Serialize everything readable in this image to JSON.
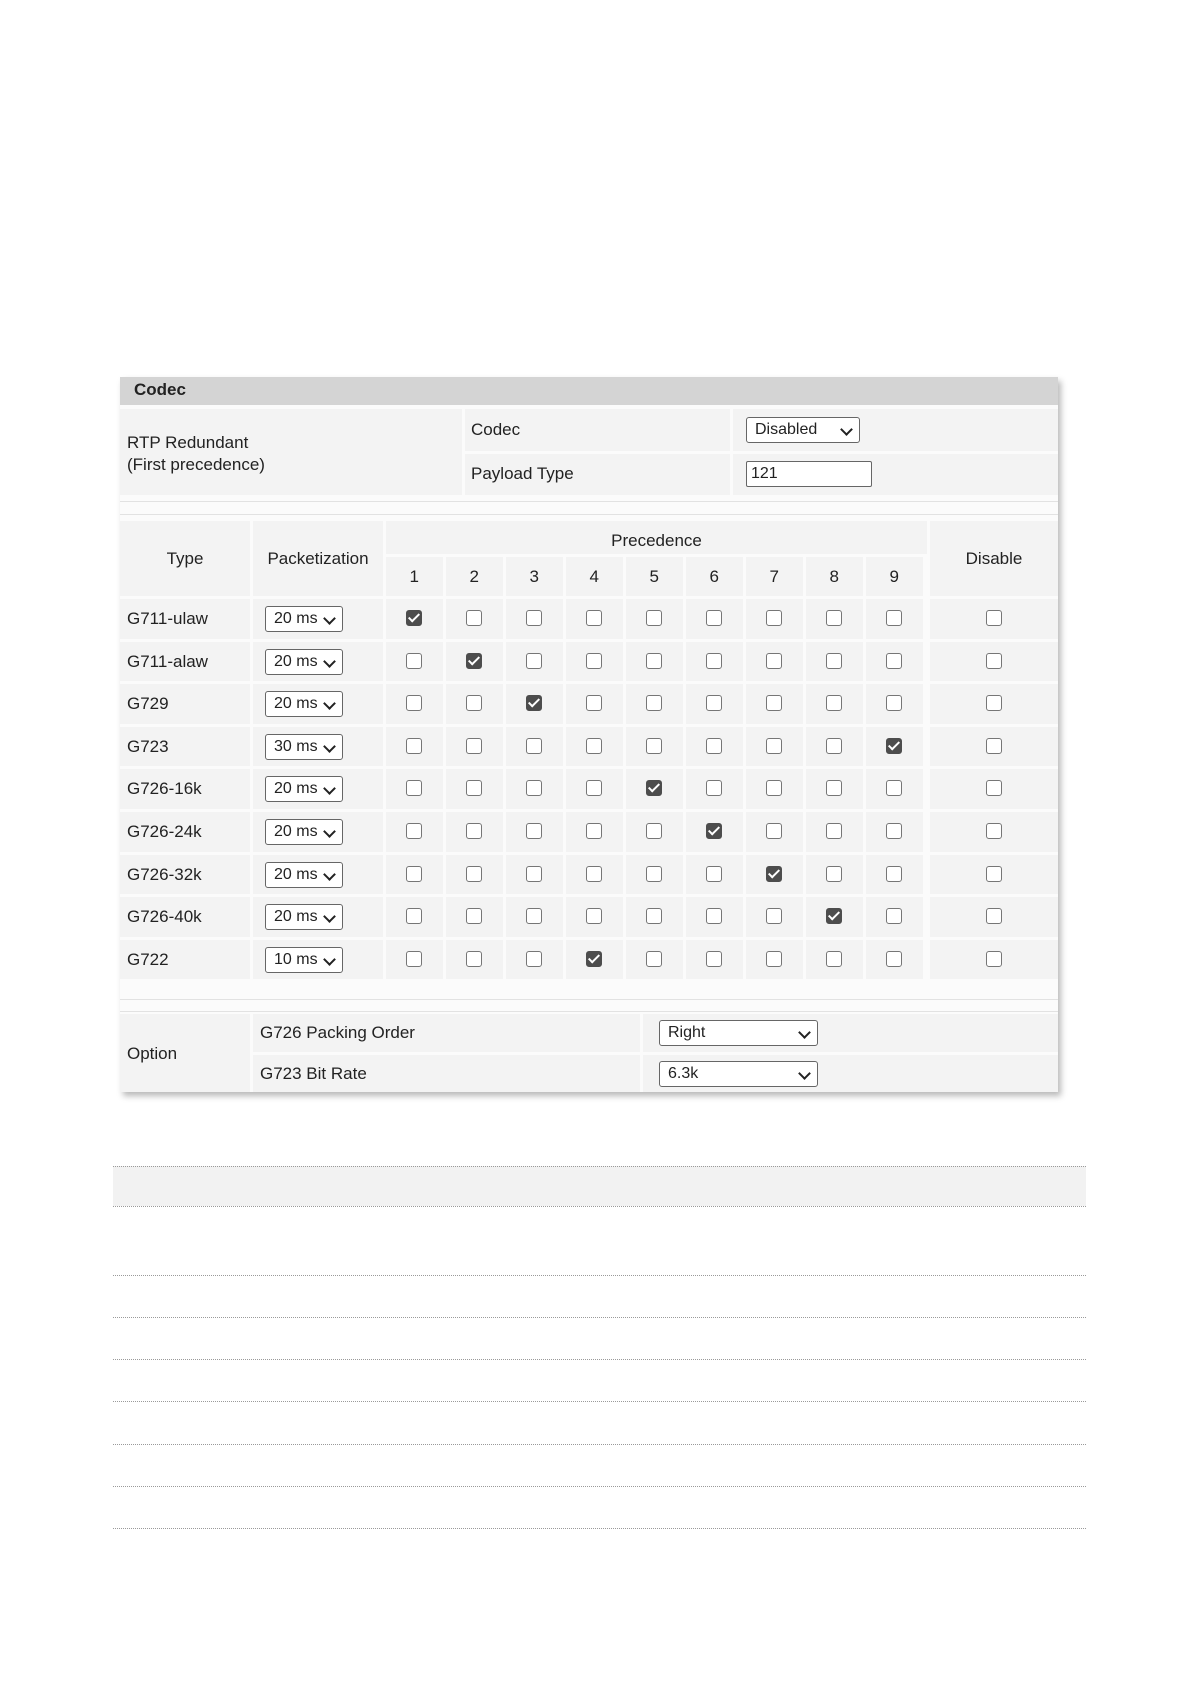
{
  "panel_title": "Codec",
  "rtp": {
    "label_line1": "RTP Redundant",
    "label_line2": "(First precedence)",
    "codec_label": "Codec",
    "codec_value": "Disabled",
    "payload_label": "Payload Type",
    "payload_value": "121"
  },
  "table": {
    "type_header": "Type",
    "packetization_header": "Packetization",
    "precedence_header": "Precedence",
    "disable_header": "Disable",
    "precedence_columns": [
      "1",
      "2",
      "3",
      "4",
      "5",
      "6",
      "7",
      "8",
      "9"
    ],
    "rows": [
      {
        "type": "G711-ulaw",
        "packetization": "20 ms",
        "precedence": 1,
        "disabled": false
      },
      {
        "type": "G711-alaw",
        "packetization": "20 ms",
        "precedence": 2,
        "disabled": false
      },
      {
        "type": "G729",
        "packetization": "20 ms",
        "precedence": 3,
        "disabled": false
      },
      {
        "type": "G723",
        "packetization": "30 ms",
        "precedence": 9,
        "disabled": false
      },
      {
        "type": "G726-16k",
        "packetization": "20 ms",
        "precedence": 5,
        "disabled": false
      },
      {
        "type": "G726-24k",
        "packetization": "20 ms",
        "precedence": 6,
        "disabled": false
      },
      {
        "type": "G726-32k",
        "packetization": "20 ms",
        "precedence": 7,
        "disabled": false
      },
      {
        "type": "G726-40k",
        "packetization": "20 ms",
        "precedence": 8,
        "disabled": false
      },
      {
        "type": "G722",
        "packetization": "10 ms",
        "precedence": 4,
        "disabled": false
      }
    ]
  },
  "option": {
    "label": "Option",
    "packing_order_label": "G726 Packing Order",
    "packing_order_value": "Right",
    "bit_rate_label": "G723 Bit Rate",
    "bit_rate_value": "6.3k"
  }
}
